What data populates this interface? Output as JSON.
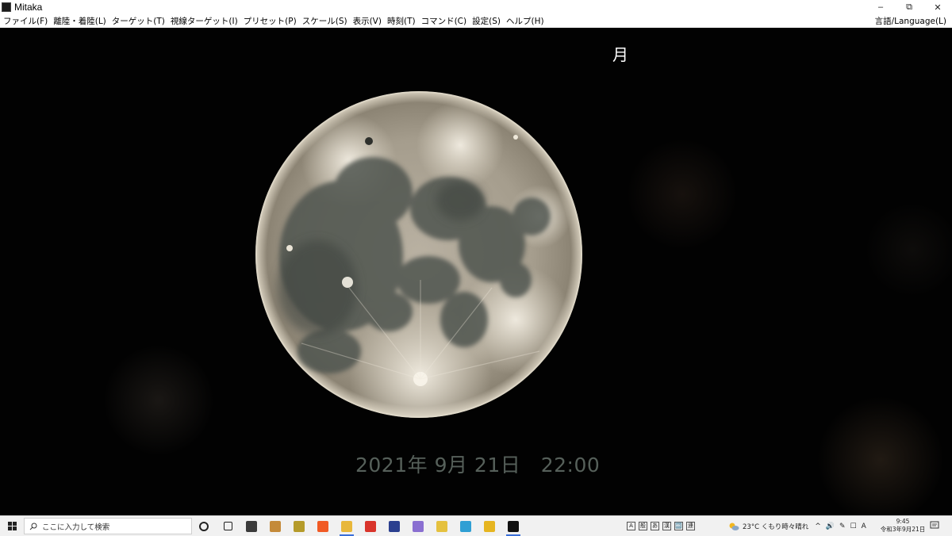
{
  "window": {
    "title": "Mitaka",
    "controls": {
      "minimize": "–",
      "restore": "⧉",
      "close": "✕"
    }
  },
  "menu": {
    "items": [
      "ファイル(F)",
      "離陸・着陸(L)",
      "ターゲット(T)",
      "視線ターゲット(I)",
      "プリセット(P)",
      "スケール(S)",
      "表示(V)",
      "時刻(T)",
      "コマンド(C)",
      "設定(S)",
      "ヘルプ(H)"
    ],
    "language": "言語/Language(L)"
  },
  "viewport": {
    "target_label": "月",
    "datetime": "2021年 9月 21日　22:00"
  },
  "taskbar": {
    "search_placeholder": "ここに入力して検索",
    "app_icons": [
      {
        "name": "cortana-icon",
        "color": "#222222"
      },
      {
        "name": "task-view-icon",
        "color": "#222222"
      },
      {
        "name": "store-icon",
        "color": "#3b3b3b"
      },
      {
        "name": "archive-app-icon",
        "color": "#c48a3a"
      },
      {
        "name": "app-icon-3",
        "color": "#b59b2a"
      },
      {
        "name": "brave-browser-icon",
        "color": "#f15a24"
      },
      {
        "name": "file-explorer-icon",
        "color": "#e8b73a"
      },
      {
        "name": "media-app-icon",
        "color": "#d9342b"
      },
      {
        "name": "app-icon-7",
        "color": "#2b3f8f"
      },
      {
        "name": "calendar-app-icon",
        "color": "#8a6fd1"
      },
      {
        "name": "folder-app-icon",
        "color": "#e5c13f"
      },
      {
        "name": "paint-app-icon",
        "color": "#2f9fd4"
      },
      {
        "name": "app-icon-11",
        "color": "#e6b520"
      },
      {
        "name": "mitaka-app-icon",
        "color": "#111111"
      }
    ],
    "ime_glyphs": [
      "A",
      "般",
      "あ",
      "漢",
      "🔤",
      "連"
    ],
    "weather": "23°C  くもり時々晴れ",
    "tray_symbols": [
      "^",
      "🔊",
      "✎",
      "☐",
      "A"
    ],
    "clock_time": "9:45",
    "clock_date": "令和3年9月21日"
  }
}
